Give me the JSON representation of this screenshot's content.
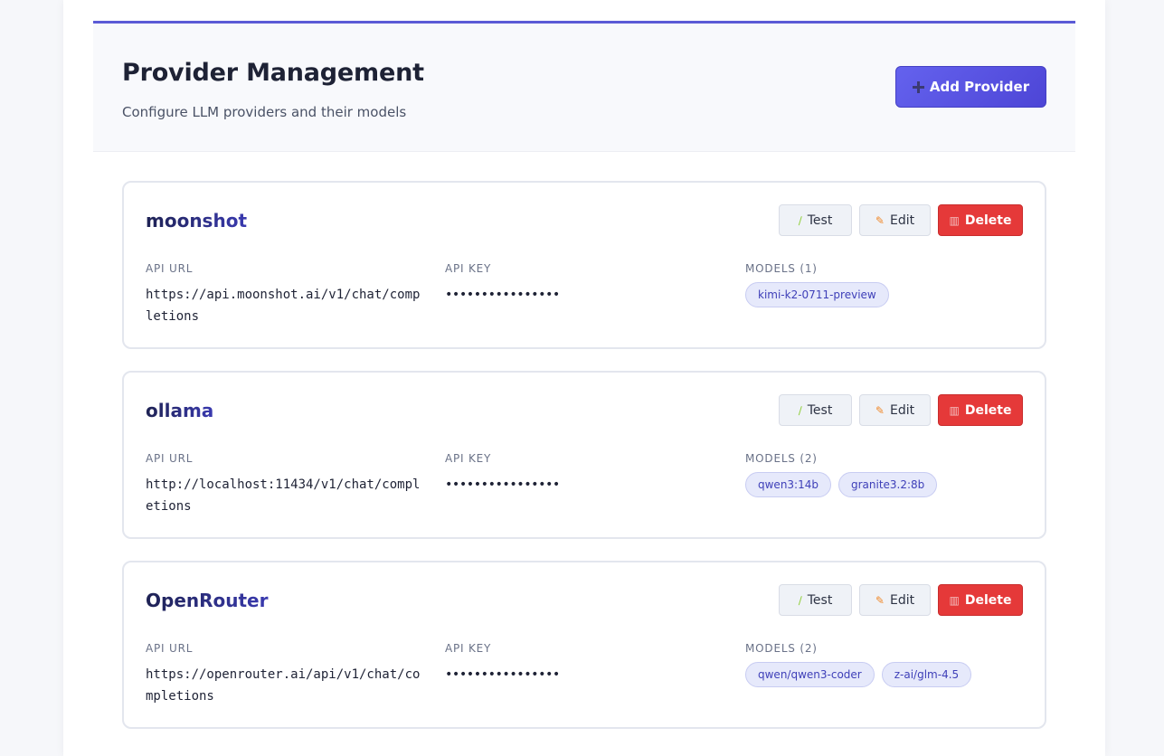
{
  "header": {
    "title": "Provider Management",
    "subtitle": "Configure LLM providers and their models",
    "add_button": "Add Provider"
  },
  "labels": {
    "api_url": "API URL",
    "api_key": "API KEY"
  },
  "buttons": {
    "test": "Test",
    "edit": "Edit",
    "delete": "Delete"
  },
  "icons": {
    "add": "plus-icon",
    "test": "test-tube-icon",
    "edit": "pencil-icon",
    "delete": "trash-icon"
  },
  "colors": {
    "accent": "#5b5bd6",
    "danger": "#e53939",
    "chip_bg": "#e6e9fb"
  },
  "providers": [
    {
      "name": "moonshot",
      "api_url": "https://api.moonshot.ai/v1/chat/completions",
      "api_key": "••••••••••••••••",
      "models_label": "MODELS (1)",
      "models": [
        "kimi-k2-0711-preview"
      ]
    },
    {
      "name": "ollama",
      "api_url": "http://localhost:11434/v1/chat/completions",
      "api_key": "••••••••••••••••",
      "models_label": "MODELS (2)",
      "models": [
        "qwen3:14b",
        "granite3.2:8b"
      ]
    },
    {
      "name": "OpenRouter",
      "api_url": "https://openrouter.ai/api/v1/chat/completions",
      "api_key": "••••••••••••••••",
      "models_label": "MODELS (2)",
      "models": [
        "qwen/qwen3-coder",
        "z-ai/glm-4.5"
      ]
    }
  ]
}
